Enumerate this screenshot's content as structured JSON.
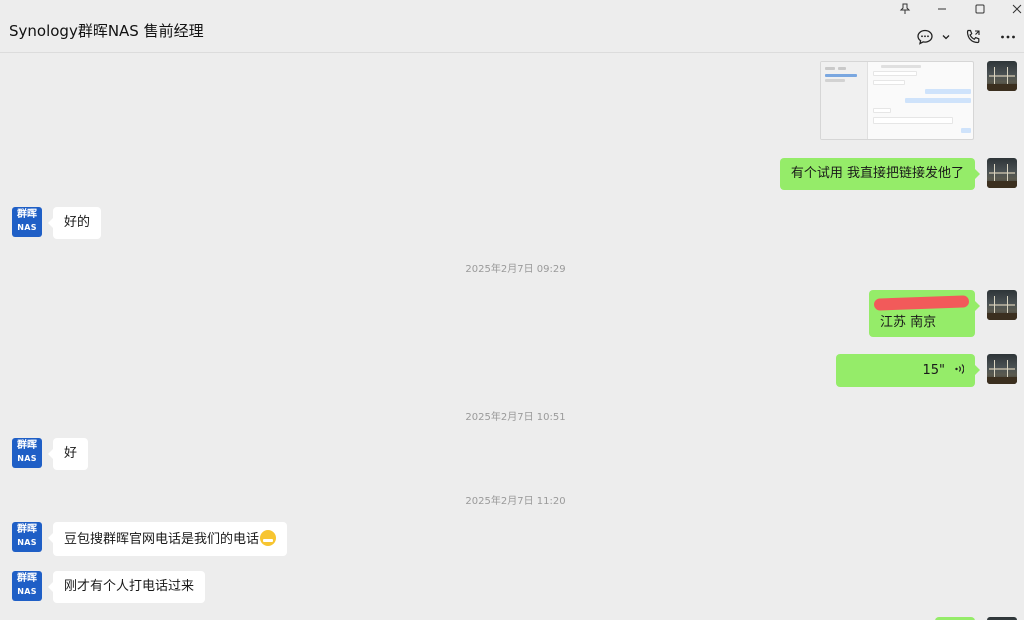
{
  "window": {
    "title": "Synology群晖NAS 售前经理",
    "controls": {
      "pin": "pin-icon",
      "minimize": "minimize-icon",
      "maximize": "maximize-icon",
      "close": "close-icon"
    },
    "toolbar": {
      "chat": "chat-bubble-icon",
      "chevron": "chevron-down-icon",
      "call": "phone-call-icon",
      "more": "more-icon"
    }
  },
  "contact": {
    "avatar_line1": "群晖",
    "avatar_line2": "NAS"
  },
  "messages": {
    "m1_image": "screenshot-image",
    "m2_text": "有个试用 我直接把链接发他了",
    "m3_text": "好的",
    "t1": "2025年2月7日 09:29",
    "m4_line2": "江苏 南京",
    "m5_voice": "15\"",
    "t2": "2025年2月7日 10:51",
    "m6_text": "好",
    "t3": "2025年2月7日 11:20",
    "m7_text": "豆包搜群晖官网电话是我们的电话",
    "m8_text": "刚才有个人打电话过来"
  },
  "colors": {
    "outgoing_bubble": "#95ec69",
    "incoming_bubble": "#ffffff",
    "background": "#ededed",
    "brand_avatar": "#1f5fc6",
    "redaction": "#f25a5a"
  }
}
